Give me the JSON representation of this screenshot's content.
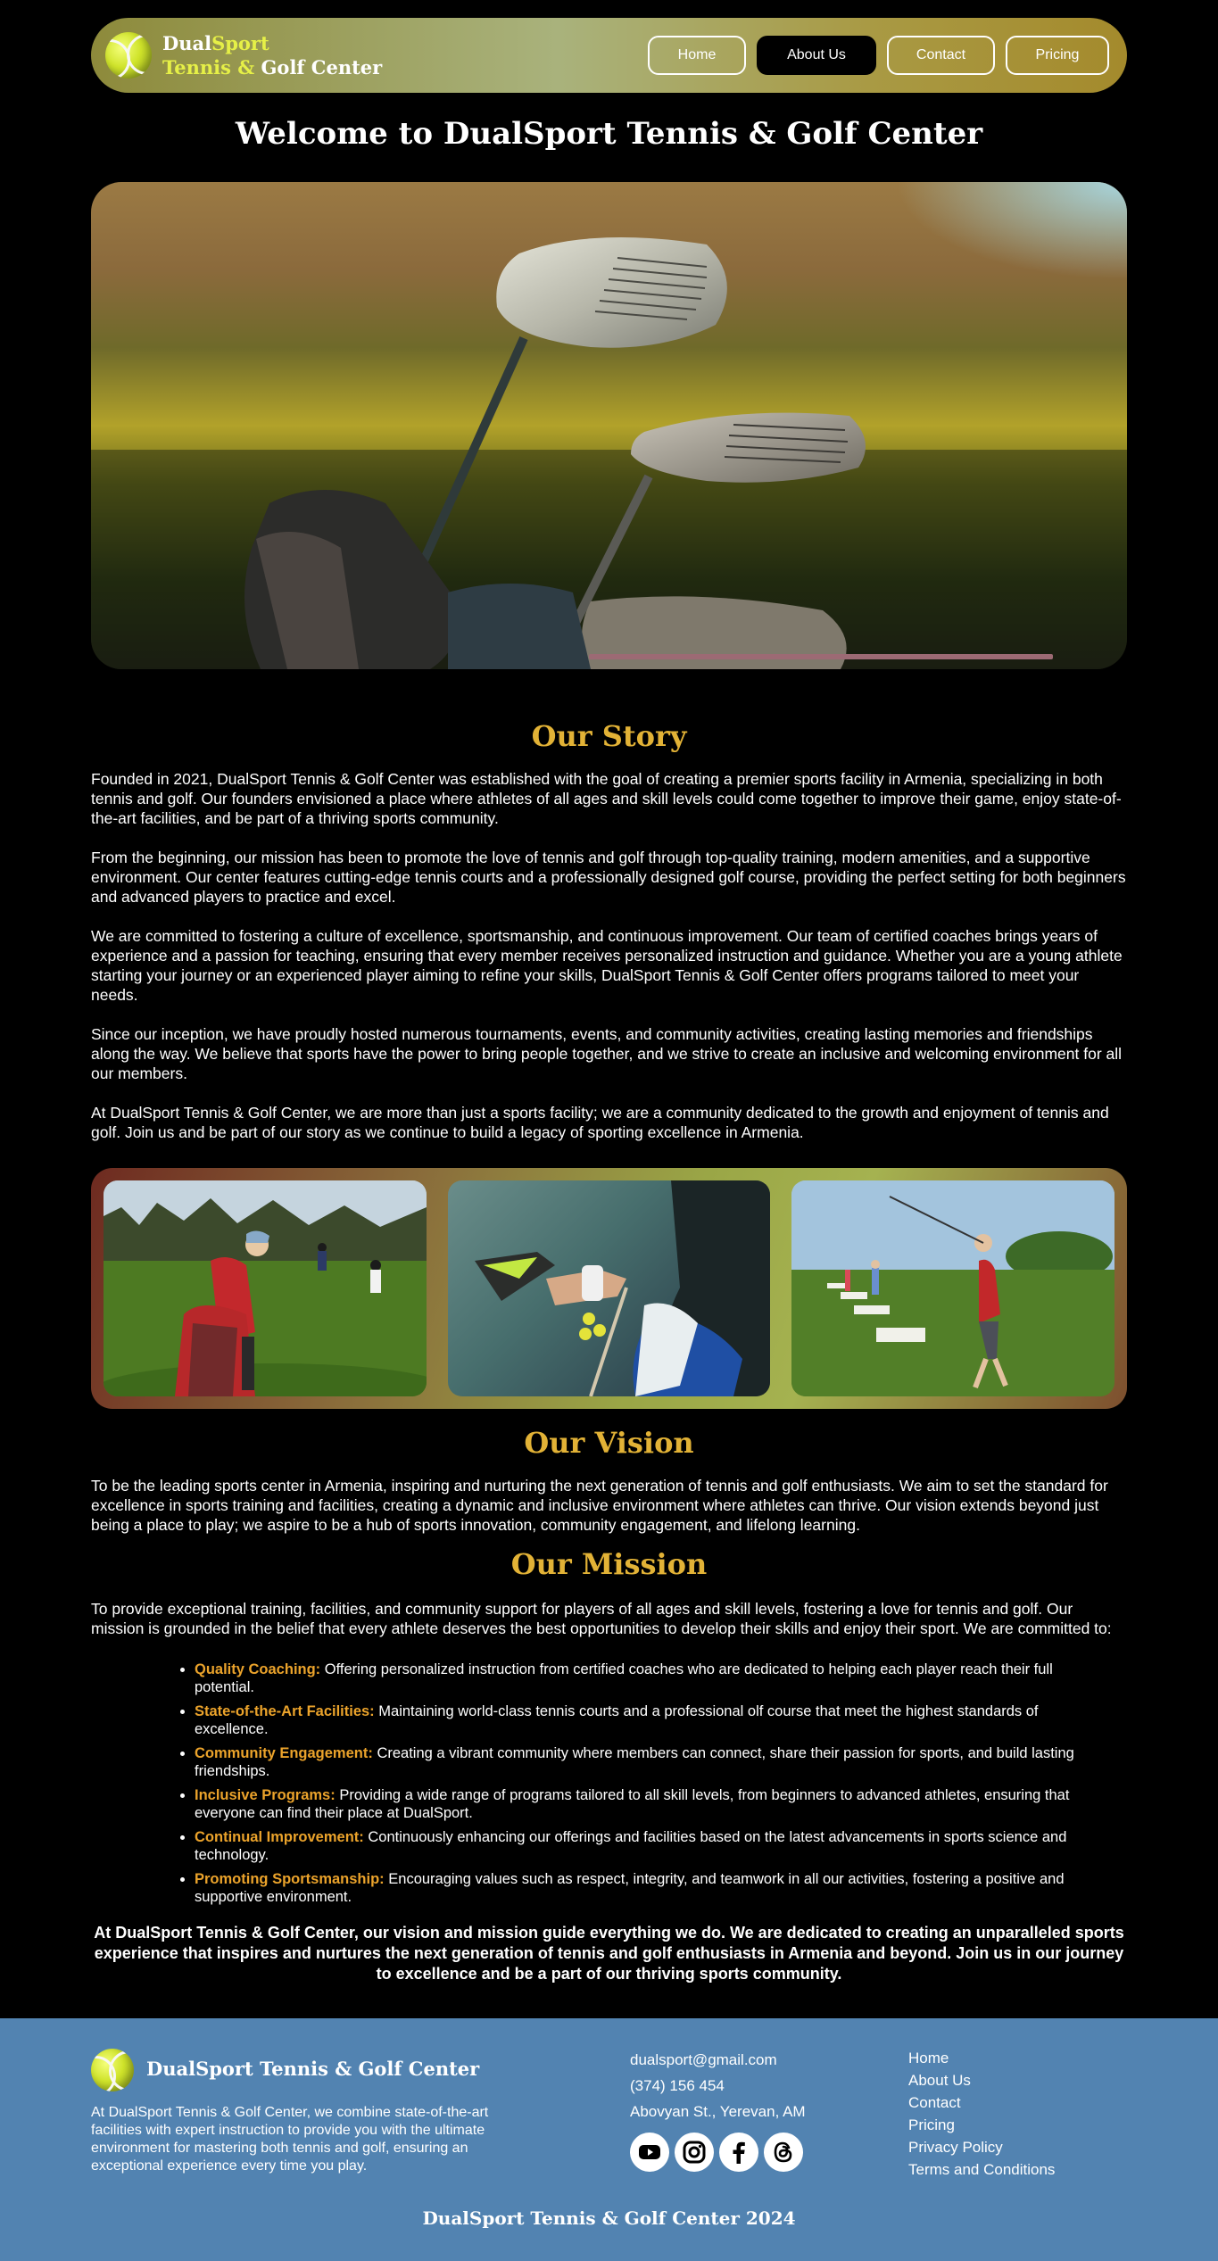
{
  "header": {
    "brand_line1_a": "Dual",
    "brand_line1_b": "Sport",
    "brand_line2_a": "Tennis & ",
    "brand_line2_b": "Golf Center",
    "nav": [
      {
        "label": "Home"
      },
      {
        "label": "About Us"
      },
      {
        "label": "Contact"
      },
      {
        "label": "Pricing"
      }
    ],
    "active_nav": "About Us"
  },
  "hero": {
    "title": "Welcome to DualSport Tennis & Golf Center",
    "image_icon": "golf-clubs-photo",
    "progress": 0.5
  },
  "story": {
    "title": "Our Story",
    "paragraphs": [
      "Founded in 2021, DualSport Tennis & Golf Center was established with the goal of creating a premier sports facility in Armenia, specializing in both tennis and golf. Our founders envisioned a place where athletes of all ages and skill levels could come together to improve their game, enjoy state-of-the-art facilities, and be part of a thriving sports community.",
      "From the beginning, our mission has been to promote the love of tennis and golf through top-quality training, modern amenities, and a supportive environment. Our center features cutting-edge tennis courts and a professionally designed golf course, providing the perfect setting for both beginners and advanced players to practice and excel.",
      "We are committed to fostering a culture of excellence, sportsmanship, and continuous improvement. Our team of certified coaches brings years of experience and a passion for teaching, ensuring that every member receives personalized instruction and guidance. Whether you are a young athlete starting your journey or an experienced player aiming to refine your skills, DualSport Tennis & Golf Center offers programs tailored to meet your needs.",
      "Since our inception, we have proudly hosted numerous tournaments, events, and community activities, creating lasting memories and friendships along the way. We believe that sports have the power to bring people together, and we strive to create an inclusive and welcoming environment for all our members.",
      "At DualSport Tennis & Golf Center, we are more than just a sports facility; we are a community dedicated to the growth and enjoyment of tennis and golf. Join us and be part of our story as we continue to build a legacy of sporting excellence in Armenia."
    ]
  },
  "gallery": [
    {
      "icon": "golfer-with-bag-photo"
    },
    {
      "icon": "padel-player-photo"
    },
    {
      "icon": "golf-swing-photo"
    }
  ],
  "vision": {
    "title": "Our Vision",
    "text": "To be the leading sports center in Armenia, inspiring and nurturing the next generation of tennis and golf enthusiasts. We aim to set the standard for excellence in sports training and facilities, creating a dynamic and inclusive environment where athletes can thrive. Our vision extends beyond just being a place to play; we aspire to be a hub of sports innovation, community engagement, and lifelong learning."
  },
  "mission": {
    "title": "Our Mission",
    "intro": "To provide exceptional training, facilities, and community support for players of all ages and skill levels, fostering a love for tennis and golf. Our mission is grounded in the belief that every athlete deserves the best opportunities to develop their skills and enjoy their sport. We are committed to:",
    "items": [
      {
        "key": "Quality Coaching:",
        "text": " Offering personalized instruction from certified coaches who are dedicated to helping each player reach their full potential."
      },
      {
        "key": "State-of-the-Art Facilities:",
        "text": " Maintaining world-class tennis courts and a professional olf course that meet the highest standards of excellence."
      },
      {
        "key": "Community Engagement:",
        "text": " Creating a vibrant community where members can connect, share their passion for sports, and build lasting friendships."
      },
      {
        "key": "Inclusive Programs:",
        "text": " Providing a wide range of programs tailored to all skill levels, from beginners to advanced athletes, ensuring that everyone can find their place at DualSport."
      },
      {
        "key": "Continual Improvement:",
        "text": " Continuously enhancing our offerings and facilities based on the latest advancements in sports science and technology."
      },
      {
        "key": "Promoting Sportsmanship:",
        "text": " Encouraging values such as respect, integrity, and teamwork in all our activities, fostering a positive and supportive environment."
      }
    ],
    "closing": "At DualSport Tennis & Golf Center, our vision and mission guide everything we do. We are dedicated to creating an unparalleled sports experience that inspires and nurtures the next generation of tennis and golf enthusiasts in Armenia and beyond. Join us in our journey to excellence and be a part of our thriving sports community."
  },
  "footer": {
    "brand": "DualSport Tennis & Golf Center",
    "description": "At DualSport Tennis & Golf Center, we combine state-of-the-art facilities with expert instruction to provide you with the ultimate environment for mastering both tennis and golf, ensuring an exceptional experience every time you play.",
    "email": "dualsport@gmail.com",
    "phone": "(374) 156 454",
    "address": "Abovyan St., Yerevan, AM",
    "socials": [
      {
        "icon": "youtube-icon"
      },
      {
        "icon": "instagram-icon"
      },
      {
        "icon": "facebook-icon"
      },
      {
        "icon": "threads-icon"
      }
    ],
    "links": [
      {
        "label": "Home"
      },
      {
        "label": "About Us"
      },
      {
        "label": "Contact"
      },
      {
        "label": "Pricing"
      },
      {
        "label": "Privacy Policy"
      },
      {
        "label": "Terms and Conditions"
      }
    ],
    "copyright": "DualSport Tennis & Golf Center 2024"
  },
  "colors": {
    "accent_gold": "#e2b236",
    "accent_orange": "#eba32b",
    "footer_blue": "#5283b1",
    "brand_yellow": "#e6f047"
  }
}
